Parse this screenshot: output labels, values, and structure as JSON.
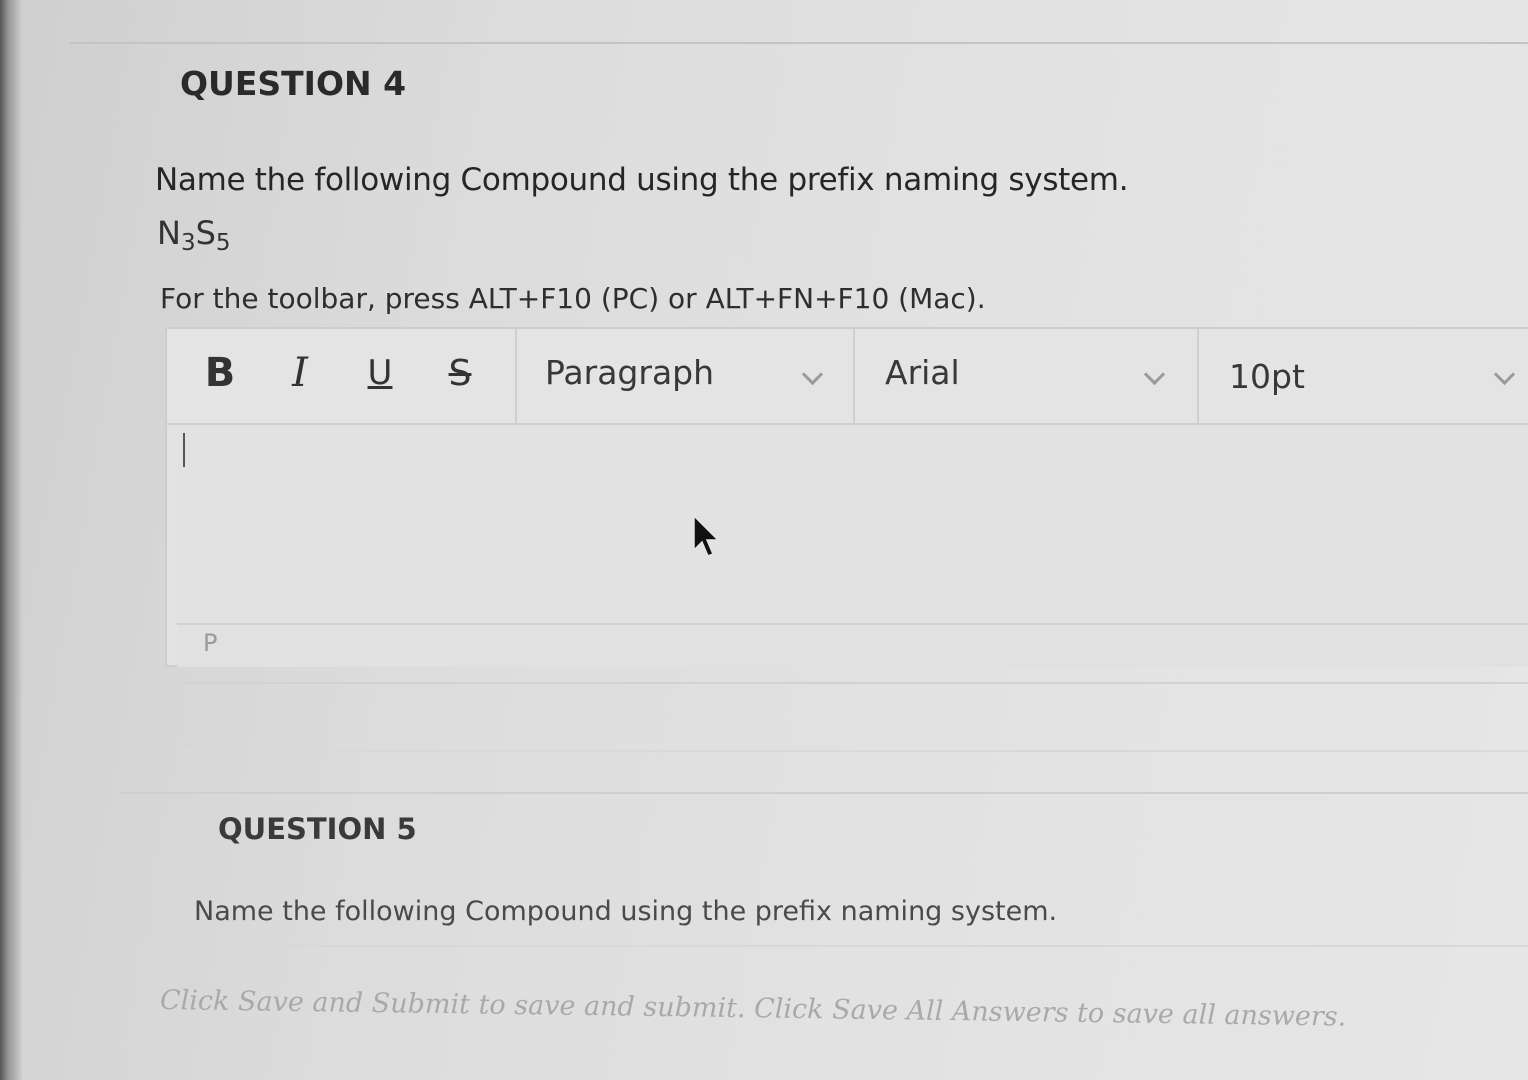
{
  "question4": {
    "heading": "QUESTION 4",
    "prompt": "Name the following Compound using the prefix naming system.",
    "formula": {
      "element1": "N",
      "subscript1": "3",
      "element2": "S",
      "subscript2": "5"
    },
    "toolbar_hint": "For the toolbar, press ALT+F10 (PC) or ALT+FN+F10 (Mac)."
  },
  "editor": {
    "format_buttons": {
      "bold": "B",
      "italic": "I",
      "underline": "U",
      "strikethrough": "S"
    },
    "block_format": "Paragraph",
    "font_family": "Arial",
    "font_size": "10pt",
    "content": "",
    "path": "P"
  },
  "question5": {
    "heading": "QUESTION 5",
    "prompt": "Name the following Compound using the prefix naming system."
  },
  "footer": {
    "instructions": "Click Save and Submit to save and submit. Click Save All Answers to save all answers."
  },
  "colors": {
    "background": "#e2e2e2",
    "text": "#2b2b2b",
    "border": "#cdcdcd",
    "footer_text": "#a9a9a9"
  }
}
